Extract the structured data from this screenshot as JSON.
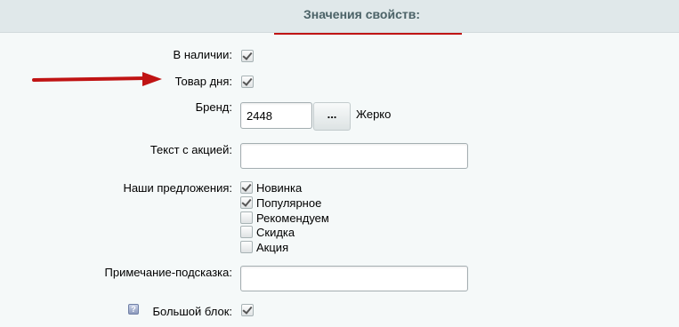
{
  "header": {
    "title": "Значения свойств:"
  },
  "fields": {
    "in_stock": {
      "label": "В наличии:",
      "checked": true
    },
    "product_of_day": {
      "label": "Товар дня:",
      "checked": true
    },
    "brand": {
      "label": "Бренд:",
      "value": "2448",
      "browse_label": "...",
      "name": "Жерко"
    },
    "promo_text": {
      "label": "Текст с акцией:",
      "value": ""
    },
    "offers": {
      "label": "Наши предложения:",
      "options": [
        {
          "label": "Новинка",
          "checked": true
        },
        {
          "label": "Популярное",
          "checked": true
        },
        {
          "label": "Рекомендуем",
          "checked": false
        },
        {
          "label": "Скидка",
          "checked": false
        },
        {
          "label": "Акция",
          "checked": false
        }
      ]
    },
    "hint_note": {
      "label": "Примечание-подсказка:",
      "value": ""
    },
    "big_block": {
      "label": "Большой блок:",
      "help_glyph": "?",
      "checked": true
    }
  },
  "colors": {
    "accent_red": "#c01414",
    "header_bg": "#e0e8ea",
    "page_bg": "#f5f9f9"
  },
  "icons": {
    "annotation": "red-arrow-icon",
    "help": "help-icon"
  }
}
